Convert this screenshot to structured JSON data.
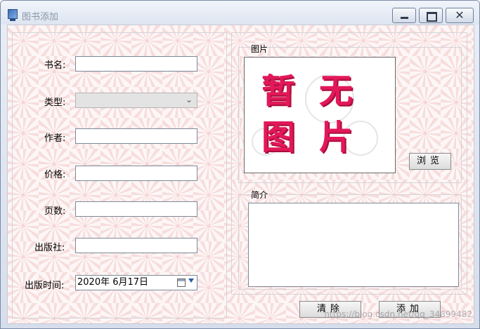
{
  "window": {
    "title": "图书添加"
  },
  "form": {
    "book_name_label": "书名:",
    "type_label": "类型:",
    "author_label": "作者:",
    "price_label": "价格:",
    "pages_label": "页数:",
    "publisher_label": "出版社:",
    "publish_time_label": "出版时间:",
    "book_name_value": "",
    "author_value": "",
    "price_value": "",
    "pages_value": "",
    "publisher_value": "",
    "type_value": "",
    "publish_time_value": "2020年  6月17日"
  },
  "image_section": {
    "label": "图片",
    "placeholder_chars": [
      "暂",
      "无",
      "图",
      "片"
    ],
    "browse_label": "浏览"
  },
  "summary_section": {
    "label": "简介",
    "value": ""
  },
  "actions": {
    "clear_label": "清除",
    "add_label": "添加"
  },
  "watermark": "https://blog.csdn.net/qq_34899482"
}
